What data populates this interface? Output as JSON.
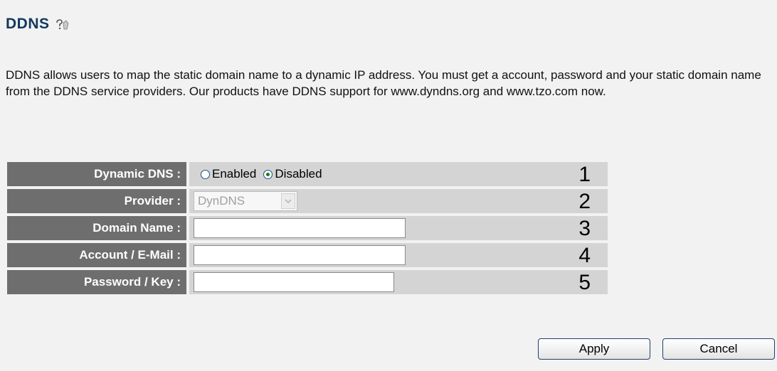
{
  "header": {
    "title": "DDNS",
    "help_icon": "help-question-icon"
  },
  "description": "DDNS allows users to map the static domain name to a dynamic IP address. You must get a account, password and your static domain name from the DDNS service providers. Our products have DDNS support for www.dyndns.org and www.tzo.com now.",
  "form": {
    "rows": [
      {
        "label": "Dynamic DNS :",
        "marker": "1",
        "options": [
          {
            "label": "Enabled",
            "checked": false
          },
          {
            "label": "Disabled",
            "checked": true
          }
        ]
      },
      {
        "label": "Provider :",
        "marker": "2",
        "selected_value": "DynDNS",
        "disabled": true
      },
      {
        "label": "Domain Name :",
        "marker": "3",
        "value": ""
      },
      {
        "label": "Account / E-Mail :",
        "marker": "4",
        "value": ""
      },
      {
        "label": "Password / Key :",
        "marker": "5",
        "value": ""
      }
    ]
  },
  "buttons": {
    "apply_label": "Apply",
    "cancel_label": "Cancel"
  },
  "colors": {
    "title": "#13385e",
    "label_bg": "#6e6e6e",
    "value_bg": "#d4d4d4",
    "page_bg": "#f2f2f2"
  }
}
